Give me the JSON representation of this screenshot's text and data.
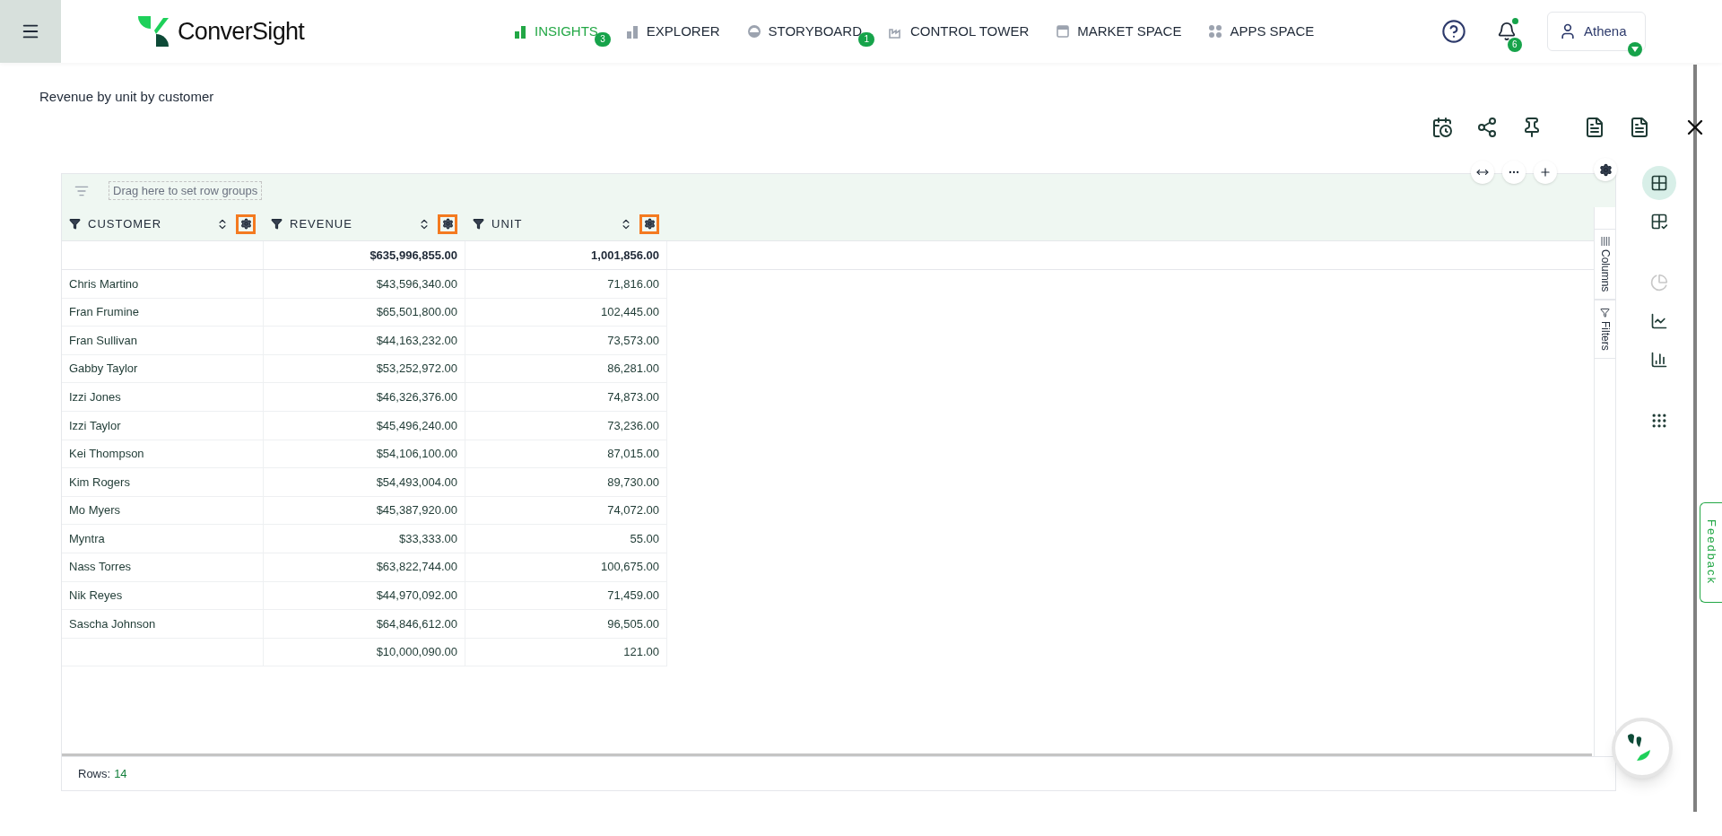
{
  "brand": "ConverSight",
  "nav": [
    {
      "kind": "insights",
      "label": "INSIGHTS",
      "selected": true,
      "badge": "3"
    },
    {
      "kind": "explorer",
      "label": "EXPLORER",
      "selected": false
    },
    {
      "kind": "storyboard",
      "label": "STORYBOARD",
      "selected": false,
      "badge": "1"
    },
    {
      "kind": "tower",
      "label": "CONTROL TOWER",
      "selected": false
    },
    {
      "kind": "market",
      "label": "MARKET SPACE",
      "selected": false
    },
    {
      "kind": "apps",
      "label": "APPS SPACE",
      "selected": false
    }
  ],
  "notifications": {
    "badge": "6",
    "unread": true
  },
  "user": {
    "name": "Athena"
  },
  "page_title": "Revenue by unit by customer",
  "group_panel": {
    "placeholder": "Drag here to set row groups"
  },
  "columns": [
    {
      "label": "CUSTOMER",
      "kind": "text",
      "highlighted": true
    },
    {
      "label": "REVENUE",
      "kind": "number",
      "highlighted": true
    },
    {
      "label": "UNIT",
      "kind": "number",
      "highlighted": true
    }
  ],
  "totals": [
    "$635,996,855.00",
    "1,001,856.00"
  ],
  "rows": [
    [
      "Chris Martino",
      "$43,596,340.00",
      "71,816.00"
    ],
    [
      "Fran Frumine",
      "$65,501,800.00",
      "102,445.00"
    ],
    [
      "Fran Sullivan",
      "$44,163,232.00",
      "73,573.00"
    ],
    [
      "Gabby Taylor",
      "$53,252,972.00",
      "86,281.00"
    ],
    [
      "Izzi Jones",
      "$46,326,376.00",
      "74,873.00"
    ],
    [
      "Izzi Taylor",
      "$45,496,240.00",
      "73,236.00"
    ],
    [
      "Kei Thompson",
      "$54,106,100.00",
      "87,015.00"
    ],
    [
      "Kim Rogers",
      "$54,493,004.00",
      "89,730.00"
    ],
    [
      "Mo Myers",
      "$45,387,920.00",
      "74,072.00"
    ],
    [
      "Myntra",
      "$33,333.00",
      "55.00"
    ],
    [
      "Nass Torres",
      "$63,822,744.00",
      "100,675.00"
    ],
    [
      "Nik Reyes",
      "$44,970,092.00",
      "71,459.00"
    ],
    [
      "Sascha Johnson",
      "$64,846,612.00",
      "96,505.00"
    ],
    [
      null,
      "$10,000,090.00",
      "121.00"
    ]
  ],
  "side_tabs": [
    {
      "kind": "columns",
      "label": "Columns"
    },
    {
      "kind": "filters",
      "label": "Filters"
    }
  ],
  "footer": {
    "label": "Rows:",
    "value": "14"
  },
  "rail": [
    {
      "kind": "table",
      "selected": true,
      "disabled": false
    },
    {
      "kind": "pivot",
      "selected": false,
      "disabled": false
    },
    {
      "kind": "pie",
      "selected": false,
      "disabled": true
    },
    {
      "kind": "line",
      "selected": false,
      "disabled": false
    },
    {
      "kind": "bar",
      "selected": false,
      "disabled": false
    },
    {
      "kind": "more",
      "selected": false,
      "disabled": false
    }
  ],
  "feedback": "Feedback"
}
